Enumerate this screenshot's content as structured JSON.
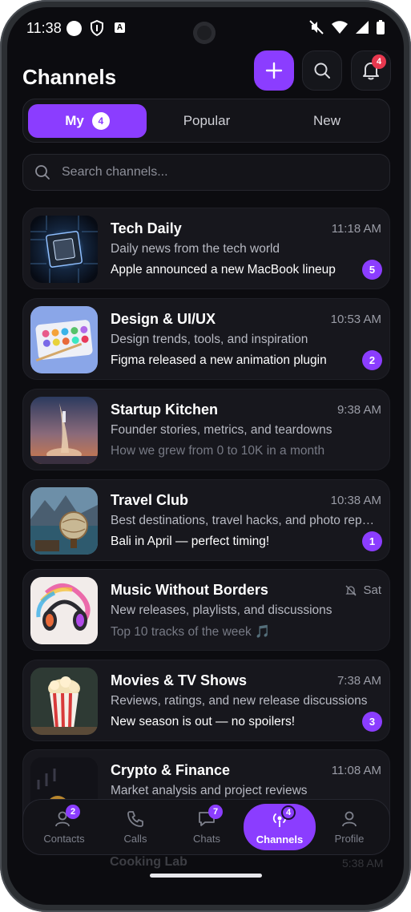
{
  "status_bar": {
    "time": "11:38",
    "icons": [
      "shield-icon",
      "a-icon",
      "mute-icon",
      "wifi-icon",
      "signal-icon",
      "battery-icon"
    ]
  },
  "header": {
    "title": "Channels",
    "notification_count": "4"
  },
  "tabs": [
    {
      "label": "My",
      "count": "4",
      "active": true
    },
    {
      "label": "Popular",
      "active": false
    },
    {
      "label": "New",
      "active": false
    }
  ],
  "search": {
    "placeholder": "Search channels..."
  },
  "channels": [
    {
      "name": "Tech Daily",
      "time": "11:18 AM",
      "description": "Daily news from the tech world",
      "last_message": "Apple announced a new MacBook lineup",
      "unread": "5",
      "muted": false
    },
    {
      "name": "Design & UI/UX",
      "time": "10:53 AM",
      "description": "Design trends, tools, and inspiration",
      "last_message": "Figma released a new animation plugin",
      "unread": "2",
      "muted": false
    },
    {
      "name": "Startup Kitchen",
      "time": "9:38 AM",
      "description": "Founder stories, metrics, and teardowns",
      "last_message": "How we grew from 0 to 10K in a month",
      "unread": "",
      "muted": false
    },
    {
      "name": "Travel Club",
      "time": "10:38 AM",
      "description": "Best destinations, travel hacks, and photo reports",
      "last_message": "Bali in April — perfect timing!",
      "unread": "1",
      "muted": false
    },
    {
      "name": "Music Without Borders",
      "time": "Sat",
      "description": "New releases, playlists, and discussions",
      "last_message": "Top 10 tracks of the week 🎵",
      "unread": "",
      "muted": true
    },
    {
      "name": "Movies & TV Shows",
      "time": "7:38 AM",
      "description": "Reviews, ratings, and new release discussions",
      "last_message": "New season is out — no spoilers!",
      "unread": "3",
      "muted": false
    },
    {
      "name": "Crypto & Finance",
      "time": "11:08 AM",
      "description": "Market analysis and project reviews",
      "last_message": "",
      "unread": "",
      "muted": false
    }
  ],
  "peek": {
    "name": "Cooking Lab",
    "time": "5:38 AM"
  },
  "bottom_nav": [
    {
      "label": "Contacts",
      "badge": "2",
      "icon": "contacts-icon",
      "active": false
    },
    {
      "label": "Calls",
      "badge": "",
      "icon": "phone-icon",
      "active": false
    },
    {
      "label": "Chats",
      "badge": "7",
      "icon": "chat-icon",
      "active": false
    },
    {
      "label": "Channels",
      "badge": "4",
      "icon": "broadcast-icon",
      "active": true
    },
    {
      "label": "Profile",
      "badge": "",
      "icon": "profile-icon",
      "active": false
    }
  ],
  "colors": {
    "accent": "#8b3dff",
    "background": "#0c0c10",
    "card": "#17171d",
    "notification_badge": "#e8384f"
  }
}
